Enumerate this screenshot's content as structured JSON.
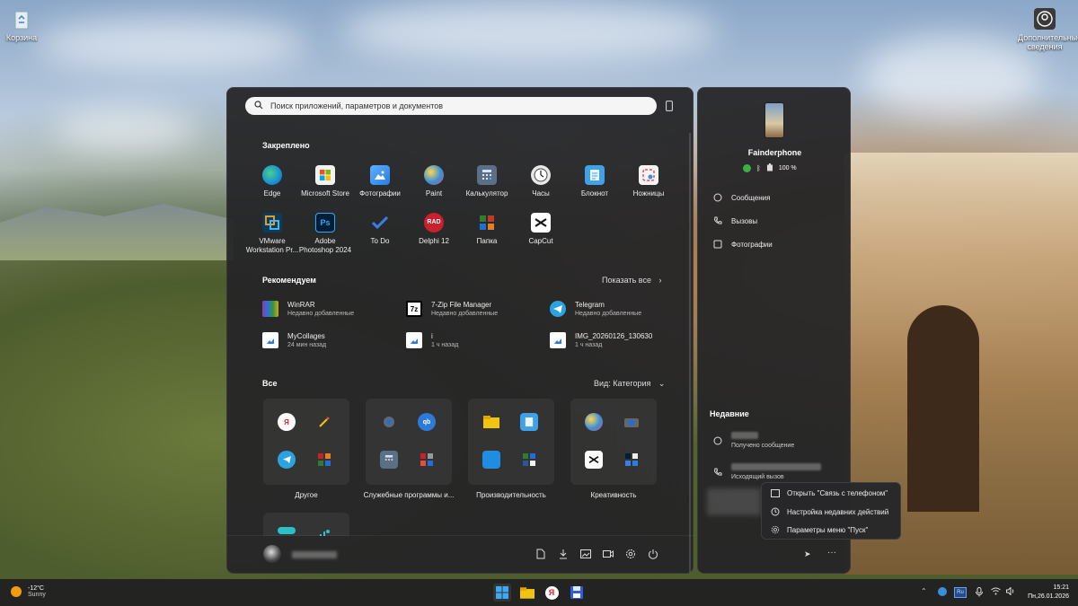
{
  "desktop": {
    "recycle_bin": "Корзина",
    "extra_info": "Дополнительные сведения"
  },
  "start": {
    "search_placeholder": "Поиск приложений, параметров и документов",
    "pinned_title": "Закреплено",
    "pinned": [
      {
        "label": "Edge",
        "icon": "edge-icon",
        "color": "#1b8fd6"
      },
      {
        "label": "Microsoft Store",
        "icon": "store-icon",
        "color": "#f2f2f2"
      },
      {
        "label": "Фотографии",
        "icon": "photos-icon",
        "color": "#2a7de1"
      },
      {
        "label": "Paint",
        "icon": "paint-icon",
        "color": "#3a8fd9"
      },
      {
        "label": "Калькулятор",
        "icon": "calculator-icon",
        "color": "#5b6f86"
      },
      {
        "label": "Часы",
        "icon": "clock-icon",
        "color": "#d0d0d0"
      },
      {
        "label": "Блокнот",
        "icon": "notepad-icon",
        "color": "#3fa1e8"
      },
      {
        "label": "Ножницы",
        "icon": "snipping-icon",
        "color": "#e94a6b"
      },
      {
        "label": "VMware Workstation Pr...",
        "icon": "vmware-icon",
        "color": "#e99a1a"
      },
      {
        "label": "Adobe Photoshop 2024",
        "icon": "photoshop-icon",
        "color": "#0a1f3a"
      },
      {
        "label": "To Do",
        "icon": "todo-icon",
        "color": "#2f6fe0"
      },
      {
        "label": "Delphi 12",
        "icon": "delphi-icon",
        "color": "#c9202e"
      },
      {
        "label": "Папка",
        "icon": "folder-group-icon",
        "color": "#2e7d32"
      },
      {
        "label": "CapCut",
        "icon": "capcut-icon",
        "color": "#ffffff"
      }
    ],
    "recommended_title": "Рекомендуем",
    "show_all": "Показать все",
    "recommended": [
      {
        "name": "WinRAR",
        "sub": "Недавно добавленные",
        "icon": "winrar-icon",
        "color": "#8a3fa0"
      },
      {
        "name": "7-Zip File Manager",
        "sub": "Недавно добавленные",
        "icon": "7zip-icon",
        "color": "#111111"
      },
      {
        "name": "Telegram",
        "sub": "Недавно добавленные",
        "icon": "telegram-icon",
        "color": "#2aa3e0"
      },
      {
        "name": "MyCollages",
        "sub": "24 мин назад",
        "icon": "image-file-icon",
        "color": "#ffffff"
      },
      {
        "name": "i",
        "sub": "1 ч назад",
        "icon": "image-file-icon",
        "color": "#ffffff"
      },
      {
        "name": "IMG_20260126_130630",
        "sub": "1 ч назад",
        "icon": "image-file-icon",
        "color": "#ffffff"
      }
    ],
    "all_title": "Все",
    "view_label": "Вид: Категория",
    "folders": [
      {
        "label": "Другое"
      },
      {
        "label": "Служебные программы и..."
      },
      {
        "label": "Производительность"
      },
      {
        "label": "Креативность"
      }
    ]
  },
  "phone": {
    "name": "Fainderphone",
    "battery": "100 %",
    "menu": [
      "Сообщения",
      "Вызовы",
      "Фотографии"
    ],
    "recent_title": "Недавние",
    "recent": [
      {
        "sub": "Получено сообщение"
      },
      {
        "sub": "Исходящий вызов"
      }
    ]
  },
  "context_menu": [
    "Открыть \"Связь с телефоном\"",
    "Настройка недавних действий",
    "Параметры меню \"Пуск\""
  ],
  "weather": {
    "temp": "-12°C",
    "cond": "Sunny"
  },
  "tray": {
    "lang": "Ru",
    "time": "15:21",
    "date": "Пн,26.01.2026"
  }
}
